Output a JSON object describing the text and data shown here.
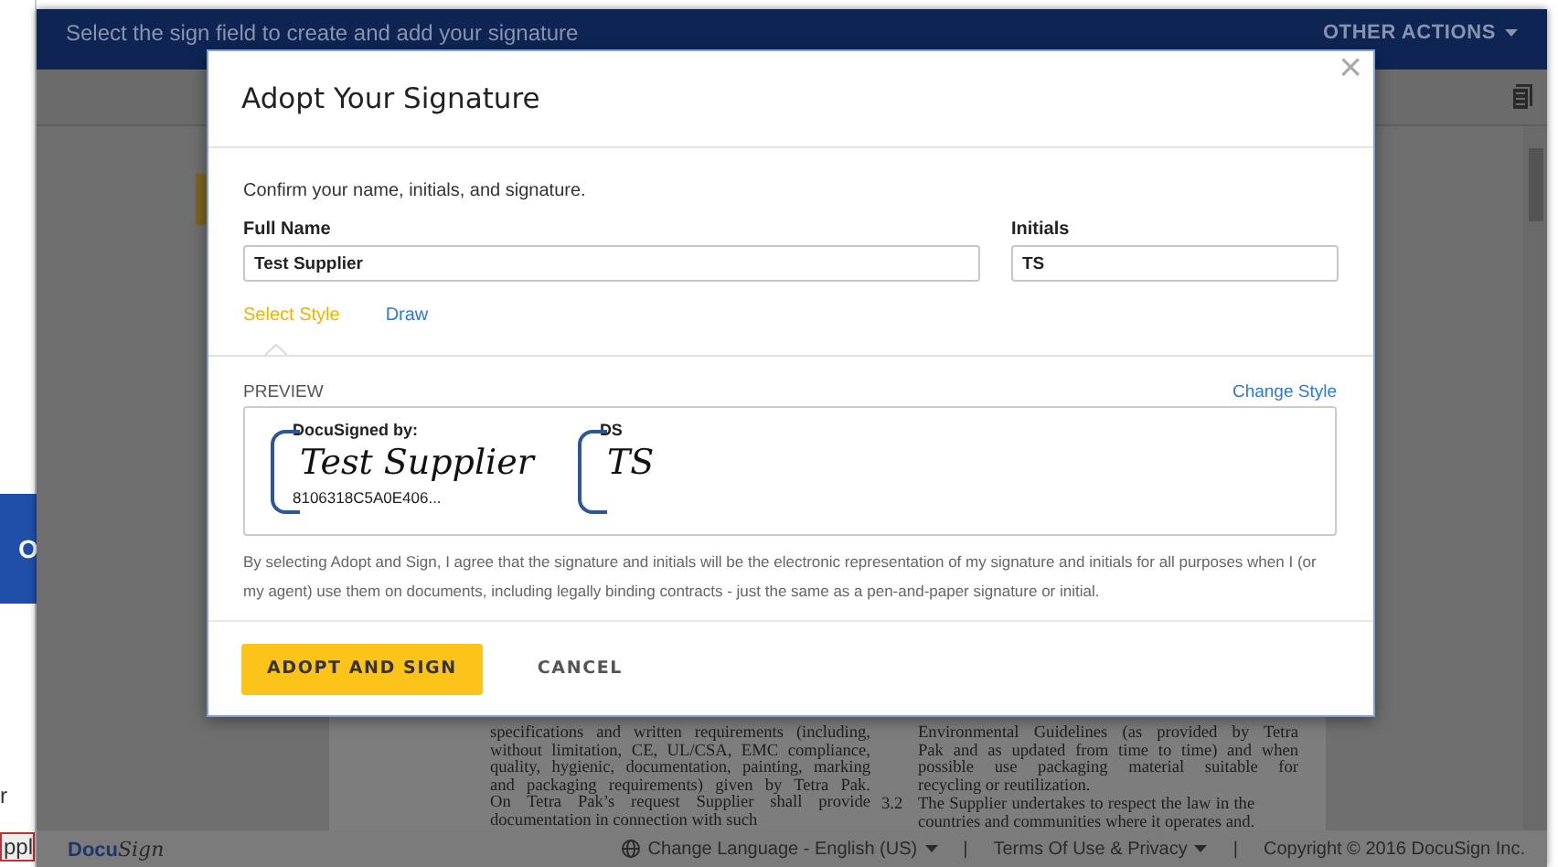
{
  "side_window": {
    "button_text": "O",
    "text": "r",
    "field_value": "ppl"
  },
  "app": {
    "banner": "Select the sign field to create and add your signature",
    "other_actions": "OTHER ACTIONS"
  },
  "document": {
    "left_lines": [
      "specifications and written requirements (including,",
      "without limitation, CE, UL/CSA, EMC compliance,",
      "quality, hygienic, documentation, painting, marking",
      "and packaging requirements) given by Tetra Pak.",
      "On Tetra Pak’s request Supplier shall provide",
      "documentation in connection with such"
    ],
    "right_lines": [
      "Environmental Guidelines (as provided by Tetra",
      "Pak and as updated from time to time) and when",
      "possible use packaging material suitable for",
      "recycling or reutilization."
    ],
    "section_number": "3.2",
    "section_lines": [
      "The Supplier undertakes to respect the law in the",
      "countries and communities where it operates and."
    ]
  },
  "footer": {
    "logo_parts": [
      "Docu",
      "Sign"
    ],
    "language": "Change Language - English (US)",
    "separators": [
      "|",
      "|"
    ],
    "terms": "Terms Of Use & Privacy",
    "copyright": "Copyright © 2016 DocuSign Inc."
  },
  "modal": {
    "title": "Adopt Your Signature",
    "close": "×",
    "intro": "Confirm your name, initials, and signature.",
    "fields": [
      {
        "label": "Full Name",
        "value": "Test Supplier"
      },
      {
        "label": "Initials",
        "value": "TS"
      }
    ],
    "tabs": [
      {
        "label": "Select Style",
        "selected": true
      },
      {
        "label": "Draw",
        "selected": false
      }
    ],
    "preview_label": "PREVIEW",
    "change_style": "Change Style",
    "signature": {
      "header": "DocuSigned by:",
      "name": "Test Supplier",
      "id": "8106318C5A0E406..."
    },
    "initials": {
      "header": "DS",
      "name": "TS"
    },
    "legal": "By selecting Adopt and Sign, I agree that the signature and initials will be the electronic representation of my signature and initials for all purposes when I (or my agent) use them on documents, including legally binding contracts - just the same as a pen-and-paper signature or initial.",
    "buttons": [
      {
        "label": "ADOPT AND SIGN",
        "kind": "primary"
      },
      {
        "label": "CANCEL",
        "kind": "secondary"
      }
    ]
  }
}
